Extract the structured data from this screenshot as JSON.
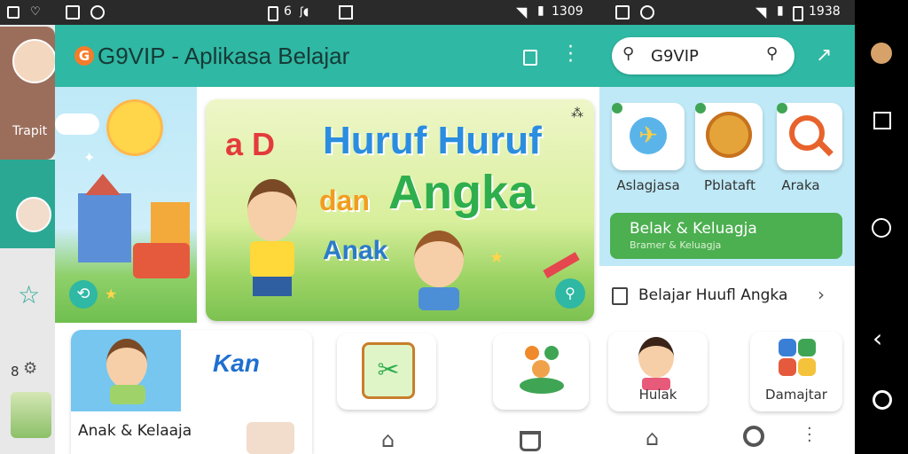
{
  "left_strip": {
    "partial_label": "Trapit",
    "partial_number": "8"
  },
  "center_status": {
    "carrier_left": "6",
    "time": "1309"
  },
  "right_status": {
    "time": "1938"
  },
  "app_bar": {
    "logo_letter": "G",
    "title": "G9VIP - Aplikasa Belajar"
  },
  "banner": {
    "prefix": "a D",
    "line1": "Huruf Huruf",
    "line2a": "dan",
    "line2b": "Angka",
    "line3": "Anak"
  },
  "left_banner": {},
  "category_row": {
    "left_card_label": "Anak & Kelaaja",
    "logo_text": "Kan"
  },
  "right_panel": {
    "search_value": "G9VIP",
    "tiles": [
      {
        "label": "Aslagjasa"
      },
      {
        "label": "Pblataft"
      },
      {
        "label": "Araka"
      }
    ],
    "green_card_title": "Belak & Keluagja",
    "green_card_subtitle": "Bramer & Keluagja",
    "list_item": "Belajar Huufl Angka",
    "bottom_cards": [
      {
        "label": "Hulak"
      },
      {
        "label": "Damajtar"
      }
    ]
  },
  "colors": {
    "teal": "#2fb8a3",
    "green": "#4caf50",
    "sky": "#bfe9f7"
  }
}
